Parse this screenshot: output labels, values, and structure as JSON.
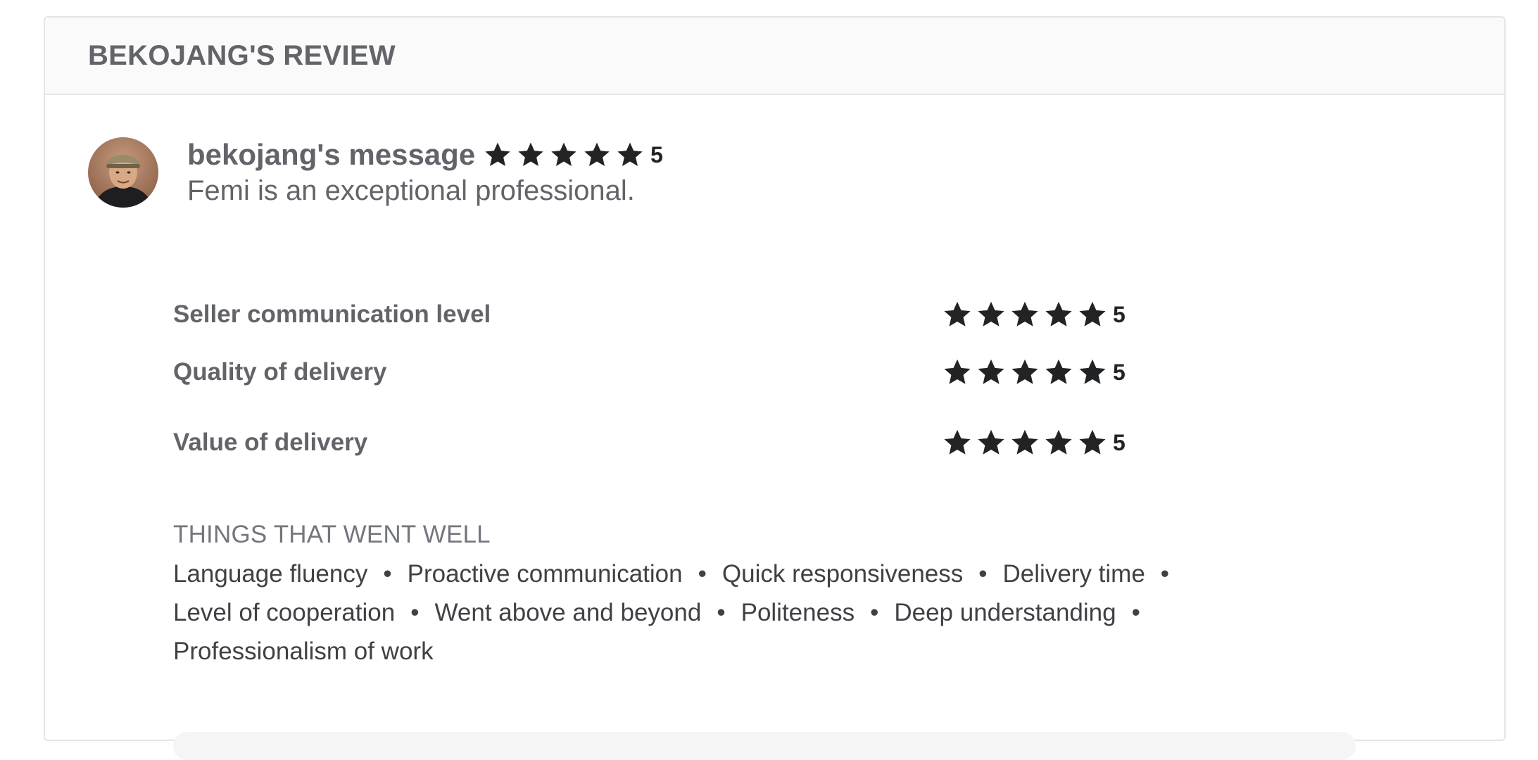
{
  "header": {
    "title": "BEKOJANG'S REVIEW"
  },
  "message": {
    "title": "bekojang's message",
    "rating": 5,
    "rating_label": "5",
    "text": "Femi is an exceptional professional."
  },
  "criteria": [
    {
      "label": "Seller communication level",
      "rating": 5,
      "rating_label": "5"
    },
    {
      "label": "Quality of delivery",
      "rating": 5,
      "rating_label": "5"
    },
    {
      "label": "Value of delivery",
      "rating": 5,
      "rating_label": "5"
    }
  ],
  "well": {
    "title": "THINGS THAT WENT WELL",
    "separator": "•",
    "tags": [
      "Language fluency",
      "Proactive communication",
      "Quick responsiveness",
      "Delivery time",
      "Level of cooperation",
      "Went above and beyond",
      "Politeness",
      "Deep understanding",
      "Professionalism of work"
    ]
  },
  "icons": {
    "star": "star-icon",
    "avatar": "user-avatar"
  },
  "colors": {
    "star": "#222325",
    "text": "#62646a",
    "header_bg": "#fafafa"
  }
}
